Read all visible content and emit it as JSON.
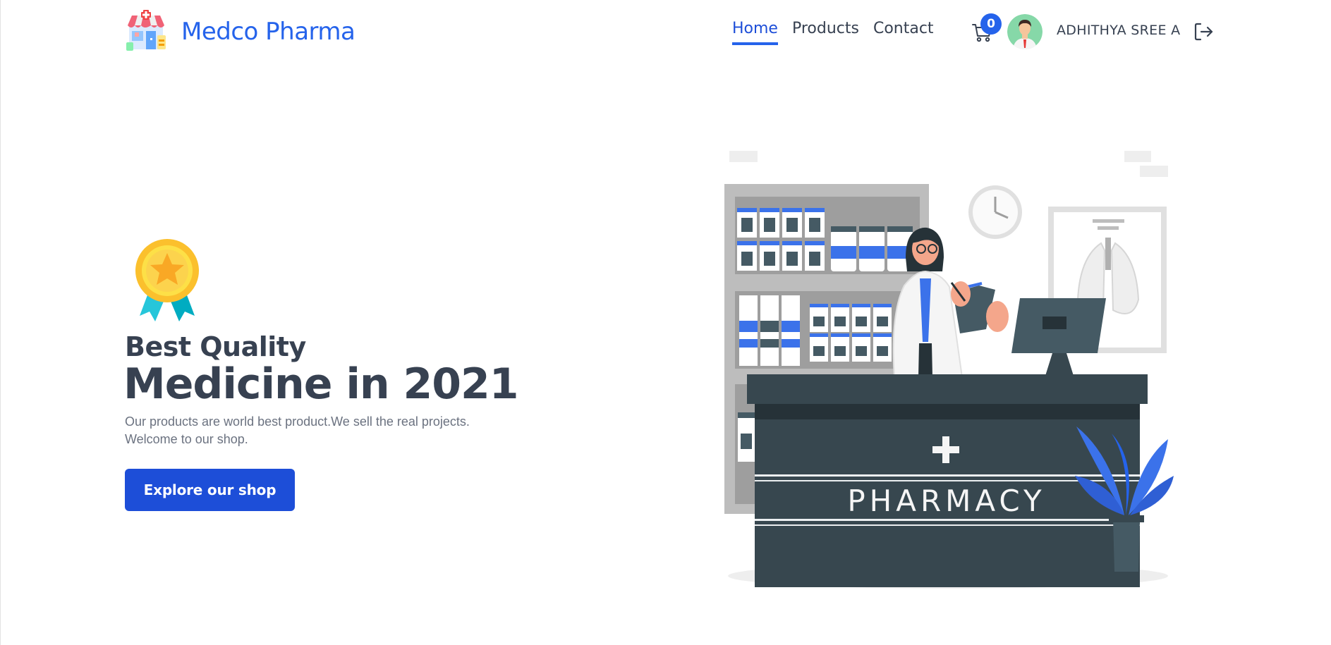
{
  "brand": {
    "name": "Medco Pharma"
  },
  "nav": {
    "links": [
      {
        "label": "Home",
        "active": true
      },
      {
        "label": "Products",
        "active": false
      },
      {
        "label": "Contact",
        "active": false
      }
    ]
  },
  "cart": {
    "count": "0"
  },
  "user": {
    "name": "ADHITHYA SREE A"
  },
  "hero": {
    "subtitle": "Best Quality",
    "title": "Medicine in 2021",
    "description": "Our products are world best product.We sell the real projects. Welcome to our shop.",
    "cta_label": "Explore our shop"
  },
  "illustration": {
    "sign_text": "PHARMACY"
  },
  "colors": {
    "accent": "#2563eb",
    "button": "#1d4ed8",
    "text_dark": "#374151",
    "text_muted": "#6b7280",
    "counter": "#37474f"
  }
}
